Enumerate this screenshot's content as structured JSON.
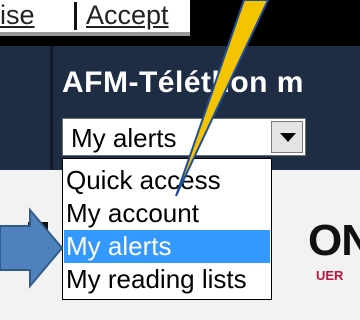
{
  "top_links": [
    {
      "label": "ise"
    },
    {
      "label": "Accept"
    }
  ],
  "site": {
    "title": "AFM-Téléthon m"
  },
  "alerts_select": {
    "selected": "My alerts",
    "options": [
      {
        "label": "Quick access"
      },
      {
        "label": "My account"
      },
      {
        "label": "My alerts"
      },
      {
        "label": "My reading lists"
      }
    ],
    "highlighted_index": 2
  },
  "logo": {
    "text": "ON",
    "subtext": "UER"
  },
  "annotations": {
    "pointer_color": "#f5c400",
    "arrow_color": "#4f81bd"
  },
  "colors": {
    "band": "#1e2d44",
    "highlight": "#3399ff"
  }
}
